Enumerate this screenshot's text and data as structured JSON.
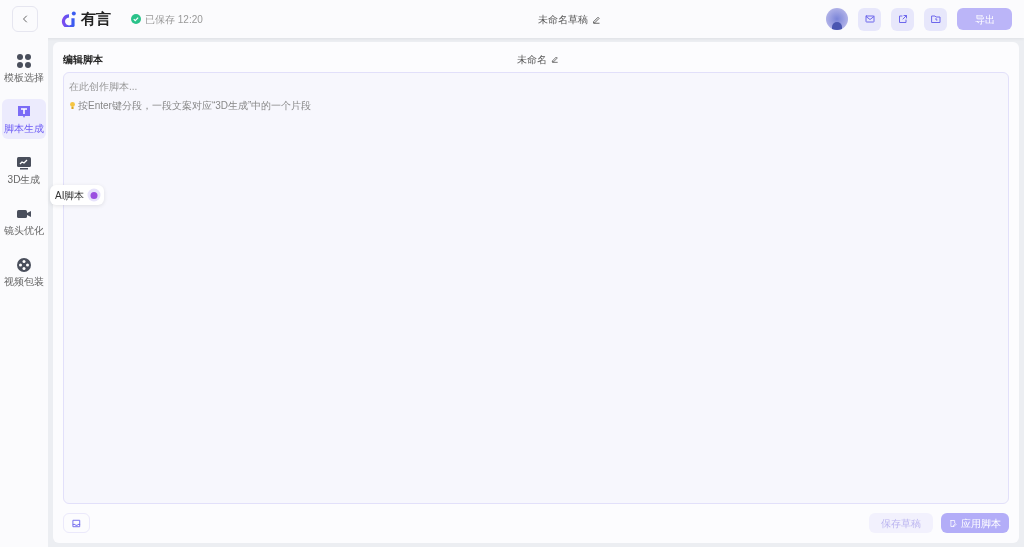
{
  "header": {
    "logo_text": "有言",
    "save_status": "已保存 12:20",
    "draft_title": "未命名草稿",
    "export_button": {
      "label": "导出",
      "disabled": true
    }
  },
  "sidebar": {
    "items": [
      {
        "label": "模板选择",
        "kind": "grid",
        "selected": false
      },
      {
        "label": "脚本生成",
        "kind": "script",
        "selected": true
      },
      {
        "label": "3D生成",
        "kind": "monitor",
        "selected": false
      },
      {
        "label": "镜头优化",
        "kind": "camera",
        "selected": false
      },
      {
        "label": "视频包装",
        "kind": "reel",
        "selected": false
      }
    ]
  },
  "ai_tooltip": "AI脚本",
  "editor": {
    "heading": "编辑脚本",
    "script_name": "未命名",
    "placeholder": "在此创作脚本...",
    "hint": "按Enter键分段，一段文案对应“3D生成”中的一个片段"
  },
  "footer": {
    "save_draft": {
      "label": "保存草稿",
      "disabled": true
    },
    "apply": {
      "label": "应用脚本",
      "disabled": false
    }
  }
}
